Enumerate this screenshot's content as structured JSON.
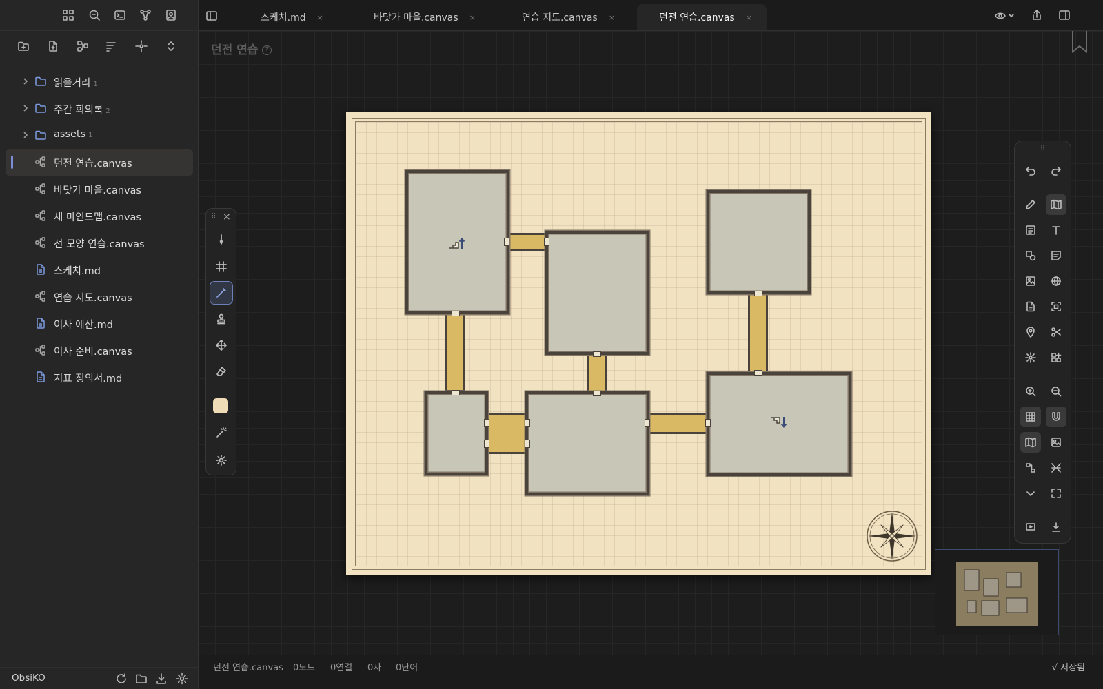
{
  "sidebar": {
    "top_icons": [
      "grid-icon",
      "search-icon",
      "terminal-icon",
      "graph-icon",
      "contact-icon"
    ],
    "actions": [
      "new-folder-icon",
      "new-note-icon",
      "canvas-icon",
      "sort-icon",
      "crosshair-icon",
      "expand-collapse-icon"
    ],
    "folders": [
      {
        "label": "읽을거리",
        "count": "1"
      },
      {
        "label": "주간 회의록",
        "count": "2"
      },
      {
        "label": "assets",
        "count": "1"
      }
    ],
    "files": [
      {
        "label": "던전 연습.canvas",
        "type": "canvas",
        "active": true
      },
      {
        "label": "바닷가 마을.canvas",
        "type": "canvas"
      },
      {
        "label": "새 마인드맵.canvas",
        "type": "canvas"
      },
      {
        "label": "선 모양 연습.canvas",
        "type": "canvas"
      },
      {
        "label": "스케치.md",
        "type": "md"
      },
      {
        "label": "연습 지도.canvas",
        "type": "canvas"
      },
      {
        "label": "이사 예산.md",
        "type": "md"
      },
      {
        "label": "이사 준비.canvas",
        "type": "canvas"
      },
      {
        "label": "지표 정의서.md",
        "type": "md"
      }
    ],
    "vault_name": "ObsiKO"
  },
  "tabs": [
    {
      "label": "스케치.md",
      "close": "×"
    },
    {
      "label": "바닷가 마을.canvas",
      "close": "×"
    },
    {
      "label": "연습 지도.canvas",
      "close": "×"
    },
    {
      "label": "던전 연습.canvas",
      "close": "×",
      "active": true
    }
  ],
  "canvas": {
    "title": "던전 연습",
    "help": "?"
  },
  "palette": {
    "tools": [
      "pen",
      "hash-grid",
      "line-brush",
      "stamp",
      "move",
      "eraser",
      "color-swatch",
      "magic-wand",
      "settings"
    ],
    "swatch_color": "#efdcb6",
    "selected": "line-brush"
  },
  "status": {
    "file": "던전 연습.canvas",
    "nodes": "0노드",
    "links": "0연결",
    "chars": "0자",
    "words": "0단어",
    "saved": "√ 저장됨"
  },
  "colors": {
    "accent": "#7a8dd6",
    "parchment": "#f1e2c2",
    "room": "#c8c6b6",
    "corridor": "#d9b964",
    "wall": "#4a433c"
  }
}
